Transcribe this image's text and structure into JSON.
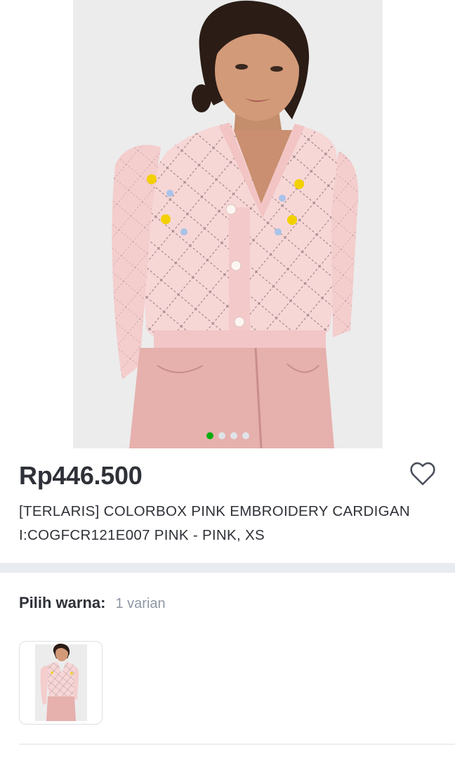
{
  "product": {
    "price": "Rp446.500",
    "title": "[TERLARIS] COLORBOX PINK EMBROIDERY CARDIGAN I:COGFCR121E007 PINK - PINK, XS",
    "image_count": 4,
    "active_image": 1,
    "wishlist_icon": "heart-outline-icon"
  },
  "variant": {
    "label": "Pilih warna:",
    "count": "1 varian"
  },
  "colors": {
    "price": "#2e3137",
    "muted": "#8d96a3",
    "accent": "#03ac0e",
    "divider": "#e8ebef"
  }
}
